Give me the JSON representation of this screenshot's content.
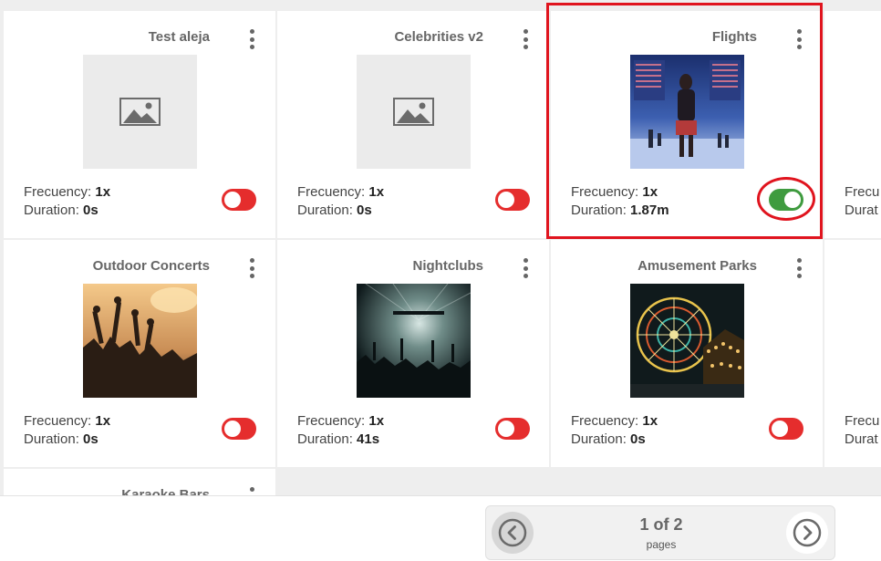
{
  "labels": {
    "frequency": "Frecuency:",
    "duration": "Duration:"
  },
  "cards": [
    {
      "title": "Test aleja",
      "frequency": "1x",
      "duration": "0s",
      "enabled": false,
      "image": "placeholder-image-icon"
    },
    {
      "title": "Celebrities v2",
      "frequency": "1x",
      "duration": "0s",
      "enabled": false,
      "image": "placeholder-image-icon"
    },
    {
      "title": "Flights",
      "frequency": "1x",
      "duration": "1.87m",
      "enabled": true,
      "image": "airport-departures-photo"
    },
    {
      "title": "Outdoor Concerts",
      "frequency": "1x",
      "duration": "0s",
      "enabled": false,
      "image": "concert-crowd-photo"
    },
    {
      "title": "Nightclubs",
      "frequency": "1x",
      "duration": "41s",
      "enabled": false,
      "image": "nightclub-stage-photo"
    },
    {
      "title": "Amusement Parks",
      "frequency": "1x",
      "duration": "0s",
      "enabled": false,
      "image": "ferris-wheel-photo"
    },
    {
      "title": "Karaoke Bars"
    }
  ],
  "partial_labels": {
    "frequency": "Frecu",
    "duration": "Durat"
  },
  "pagination": {
    "count": "1 of 2",
    "label": "pages"
  },
  "colors": {
    "toggle_on": "#3f9b3f",
    "toggle_off": "#e52d2d",
    "highlight": "#e0141e"
  }
}
